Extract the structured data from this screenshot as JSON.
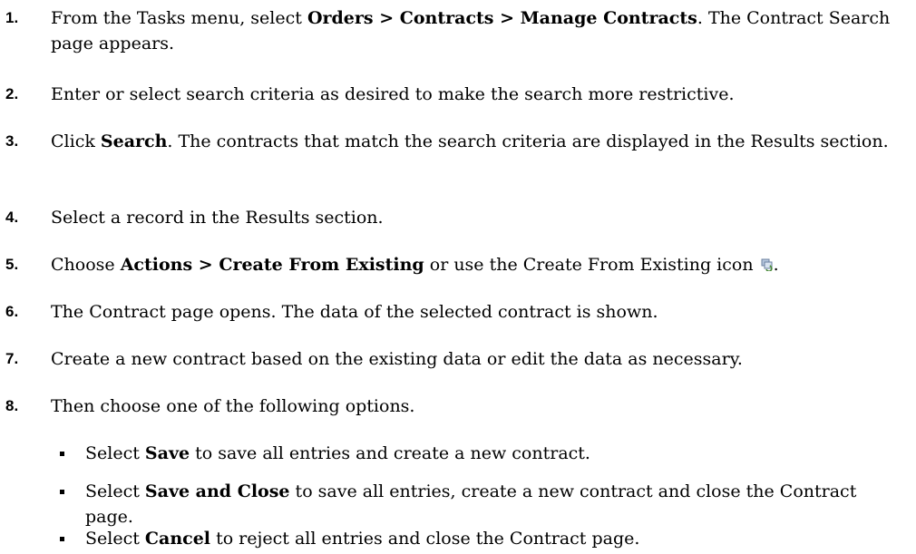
{
  "steps": [
    {
      "n": "1.",
      "pre": "From the Tasks menu, select ",
      "b1": "Orders > Contracts > Manage Contracts",
      "post": ". The Contract Search page appears."
    },
    {
      "n": "2.",
      "text": "Enter or select search criteria as desired to make the search more restrictive."
    },
    {
      "n": "3.",
      "pre": "Click ",
      "b1": "Search",
      "post": ". The contracts that match the search criteria are displayed in the Results section."
    },
    {
      "n": "4.",
      "text": "Select a record in the Results section."
    },
    {
      "n": "5.",
      "pre": "Choose ",
      "b1": "Actions > Create From Existing",
      "post": " or use the Create From Existing icon",
      "end": "."
    },
    {
      "n": "6.",
      "text": "The Contract page opens. The data of the selected contract is shown."
    },
    {
      "n": "7.",
      "text": "Create a new contract based on the existing data or edit the data as necessary."
    },
    {
      "n": "8.",
      "text": "Then choose one of the following options."
    }
  ],
  "options": [
    {
      "pre": "Select ",
      "b": "Save",
      "post": " to save all entries and create a new contract."
    },
    {
      "pre": "Select ",
      "b": "Save and Close",
      "post": " to save all entries, create a new contract and close the Contract page."
    },
    {
      "pre": "Select ",
      "b": "Cancel",
      "post": " to reject all entries and close the Contract page."
    }
  ],
  "icons": {
    "create_from_existing": "create-from-existing-icon"
  }
}
